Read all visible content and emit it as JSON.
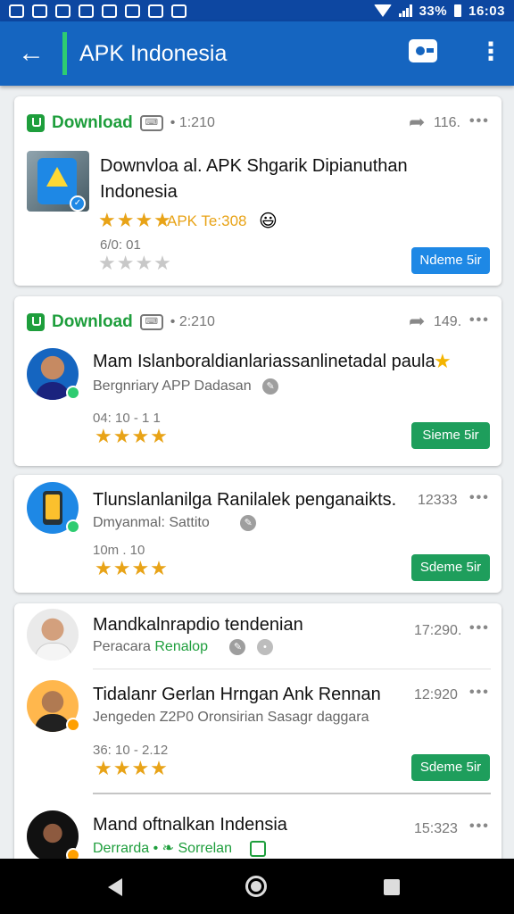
{
  "status_bar": {
    "battery": "33%",
    "time": "16:03"
  },
  "app_bar": {
    "title": "APK Indonesia"
  },
  "cards": [
    {
      "head_label": "Download",
      "head_time": "• 1:210",
      "share_count": "116.",
      "title": "Downvloa al. APK Shgarik  Dipianuthan Indonesia",
      "rating_text": "APK Te:308",
      "meta": "6/0: 01",
      "button": "Ndeme 5ir"
    },
    {
      "head_label": "Download",
      "head_time": "• 2:210",
      "share_count": "149.",
      "items": [
        {
          "title": "Mam Islanboraldianlariassanlinetadal paula",
          "subtitle": "Bergnriary APP Dadasan",
          "meta": "04: 10 - 1 1",
          "button": "Sieme 5ir"
        },
        {
          "title": "Tlunslanlanilga Ranilalek penganaikts.",
          "time": "12333",
          "subtitle": "Dmyanmal: Sattito",
          "meta": "10m . 10",
          "button": "Sdeme 5ir"
        }
      ]
    },
    {
      "items": [
        {
          "title": "Mandkalnrapdio tendenian",
          "time": "17:290.",
          "subtitle_a": "Peracara",
          "subtitle_b": "Renalop"
        },
        {
          "title": "Tidalanr Gerlan Hrngan Ank Rennan",
          "time": "12:920",
          "subtitle": "Jengeden Z2P0 Oronsirian Sasagr daggara",
          "meta": "36: 10 - 2.12",
          "button": "Sdeme 5ir"
        },
        {
          "title": "Mand oftnalkan Indensia",
          "time": "15:323",
          "subtitle_a": "Derrarda •",
          "subtitle_b": "Sorrelan"
        }
      ]
    }
  ]
}
